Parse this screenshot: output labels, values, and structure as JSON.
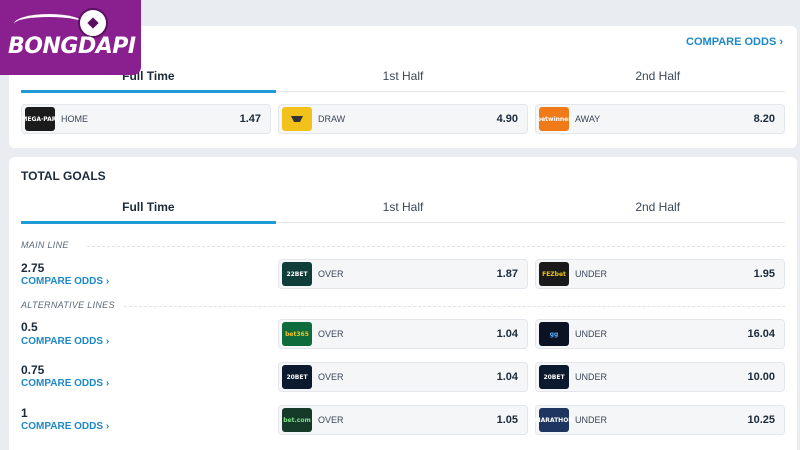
{
  "logo": {
    "text": "BONGDAPI"
  },
  "result_card": {
    "compare_link": "COMPARE ODDS ›",
    "tabs": [
      "Full Time",
      "1st Half",
      "2nd Half"
    ],
    "odds": [
      {
        "bookmaker": "MEGA PARI",
        "label": "HOME",
        "value": "1.47",
        "color": "#1b1b1b"
      },
      {
        "bookmaker": "1xbet-like",
        "label": "DRAW",
        "value": "4.90",
        "color": "#f2c21b"
      },
      {
        "bookmaker": "betwinner",
        "label": "AWAY",
        "value": "8.20",
        "color": "#f07a18"
      }
    ]
  },
  "goals_card": {
    "title": "TOTAL GOALS",
    "tabs": [
      "Full Time",
      "1st Half",
      "2nd Half"
    ],
    "main_line_label": "MAIN LINE",
    "alt_lines_label": "ALTERNATIVE LINES",
    "compare_link": "COMPARE ODDS ›",
    "lines": [
      {
        "line": "2.75",
        "over": {
          "bookmaker": "22BET",
          "label": "OVER",
          "value": "1.87",
          "color": "#0f3d3a"
        },
        "under": {
          "bookmaker": "FEZbet",
          "label": "UNDER",
          "value": "1.95",
          "color": "#1a1a1a"
        }
      },
      {
        "line": "0.5",
        "over": {
          "bookmaker": "bet365",
          "label": "OVER",
          "value": "1.04",
          "color": "#0e6b3b"
        },
        "under": {
          "bookmaker": "gg",
          "label": "UNDER",
          "value": "16.04",
          "color": "#0b1224"
        }
      },
      {
        "line": "0.75",
        "over": {
          "bookmaker": "20BET",
          "label": "OVER",
          "value": "1.04",
          "color": "#0b1a2e"
        },
        "under": {
          "bookmaker": "20BET",
          "label": "UNDER",
          "value": "10.00",
          "color": "#0b1a2e"
        }
      },
      {
        "line": "1",
        "over": {
          "bookmaker": "bet.com",
          "label": "OVER",
          "value": "1.05",
          "color": "#163a2a"
        },
        "under": {
          "bookmaker": "MARATHON",
          "label": "UNDER",
          "value": "10.25",
          "color": "#1d3560"
        }
      }
    ]
  }
}
